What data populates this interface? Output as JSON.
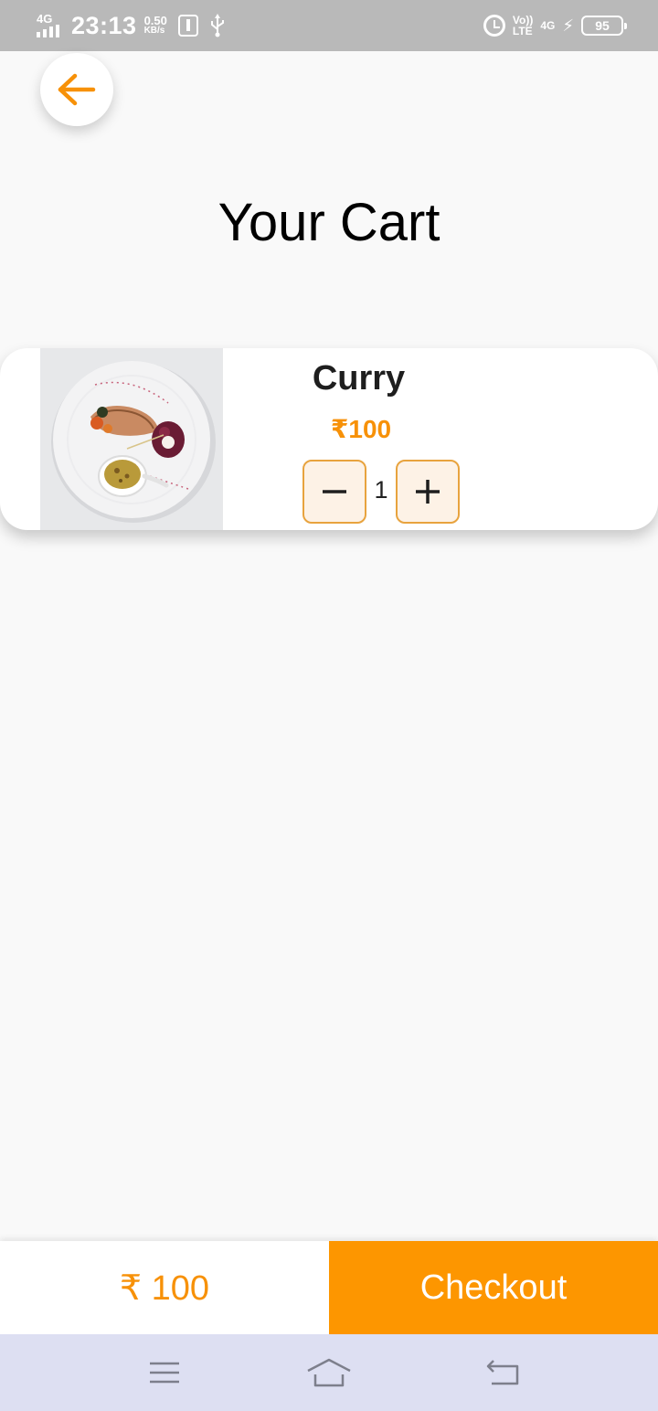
{
  "status_bar": {
    "network_type": "4G",
    "time": "23:13",
    "speed_value": "0.50",
    "speed_unit": "KB/s",
    "volte_top": "Vo))",
    "volte_bottom": "LTE",
    "network_type_right": "4G",
    "battery": "95"
  },
  "header": {
    "back_icon": "arrow-left-icon",
    "title": "Your Cart"
  },
  "cart": {
    "items": [
      {
        "name": "Curry",
        "price": "₹100",
        "quantity": "1",
        "image": "curry-dish-photo"
      }
    ]
  },
  "footer": {
    "total": "₹ 100",
    "checkout_label": "Checkout"
  },
  "colors": {
    "accent": "#fd9600",
    "price": "#f79108",
    "status_bar": "#b9b9b9",
    "nav_bar": "#dddff2"
  }
}
